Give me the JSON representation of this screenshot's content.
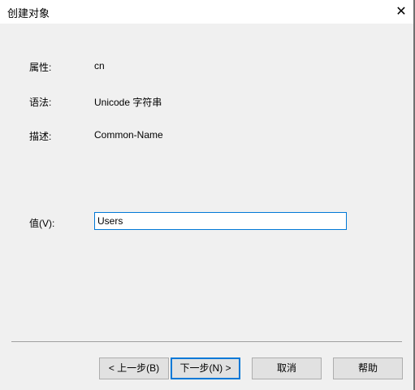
{
  "window": {
    "title": "创建对象",
    "close": "✕"
  },
  "fields": {
    "attribute_label": "属性:",
    "attribute_value": "cn",
    "syntax_label": "语法:",
    "syntax_value": "Unicode 字符串",
    "description_label": "描述:",
    "description_value": "Common-Name",
    "value_label": "值(V):",
    "value_input": "Users"
  },
  "buttons": {
    "back": "< 上一步(B)",
    "next": "下一步(N) >",
    "cancel": "取消",
    "help": "帮助"
  }
}
